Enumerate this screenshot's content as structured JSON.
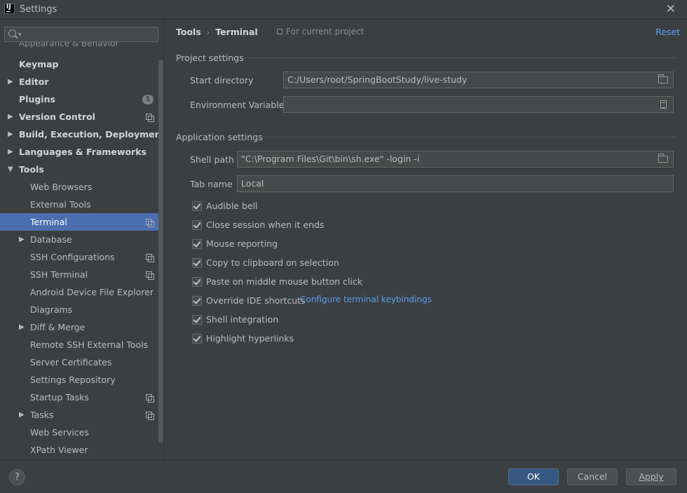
{
  "window": {
    "title": "Settings",
    "app_icon_text": "IJ"
  },
  "search": {
    "placeholder": ""
  },
  "sidebar": {
    "clipped_item": "Appearance & Behavior",
    "items": [
      {
        "label": "Keymap"
      },
      {
        "label": "Editor"
      },
      {
        "label": "Plugins",
        "badge": "1"
      },
      {
        "label": "Version Control"
      },
      {
        "label": "Build, Execution, Deployment"
      },
      {
        "label": "Languages & Frameworks"
      },
      {
        "label": "Tools"
      },
      {
        "label": "Web Browsers"
      },
      {
        "label": "External Tools"
      },
      {
        "label": "Terminal"
      },
      {
        "label": "Database"
      },
      {
        "label": "SSH Configurations"
      },
      {
        "label": "SSH Terminal"
      },
      {
        "label": "Android Device File Explorer"
      },
      {
        "label": "Diagrams"
      },
      {
        "label": "Diff & Merge"
      },
      {
        "label": "Remote SSH External Tools"
      },
      {
        "label": "Server Certificates"
      },
      {
        "label": "Settings Repository"
      },
      {
        "label": "Startup Tasks"
      },
      {
        "label": "Tasks"
      },
      {
        "label": "Web Services"
      },
      {
        "label": "XPath Viewer"
      }
    ],
    "selected": "Terminal"
  },
  "header": {
    "crumb_parent": "Tools",
    "crumb_separator": "›",
    "crumb_current": "Terminal",
    "for_project": "For current project",
    "reset": "Reset"
  },
  "project_settings": {
    "title": "Project settings",
    "start_directory_label": "Start directory",
    "start_directory_value": "C:/Users/root/SpringBootStudy/live-study",
    "env_vars_label": "Environment Variables",
    "env_vars_value": ""
  },
  "application_settings": {
    "title": "Application settings",
    "shell_path_label": "Shell path",
    "shell_path_value": "\"C:\\Program Files\\Git\\bin\\sh.exe\" -login -i",
    "tab_name_label": "Tab name",
    "tab_name_value": "Local",
    "checkboxes": [
      {
        "label": "Audible bell",
        "checked": true
      },
      {
        "label": "Close session when it ends",
        "checked": true
      },
      {
        "label": "Mouse reporting",
        "checked": true
      },
      {
        "label": "Copy to clipboard on selection",
        "checked": true
      },
      {
        "label": "Paste on middle mouse button click",
        "checked": true
      },
      {
        "label": "Override IDE shortcuts",
        "checked": true
      },
      {
        "label": "Shell integration",
        "checked": true
      },
      {
        "label": "Highlight hyperlinks",
        "checked": true
      }
    ],
    "keybindings_link": "Configure terminal keybindings"
  },
  "footer": {
    "help": "?",
    "ok": "OK",
    "cancel": "Cancel",
    "apply": "Apply"
  },
  "colors": {
    "background": "#3c3f41",
    "selection": "#4b6eaf",
    "link": "#589df6",
    "primary_button": "#365880"
  }
}
